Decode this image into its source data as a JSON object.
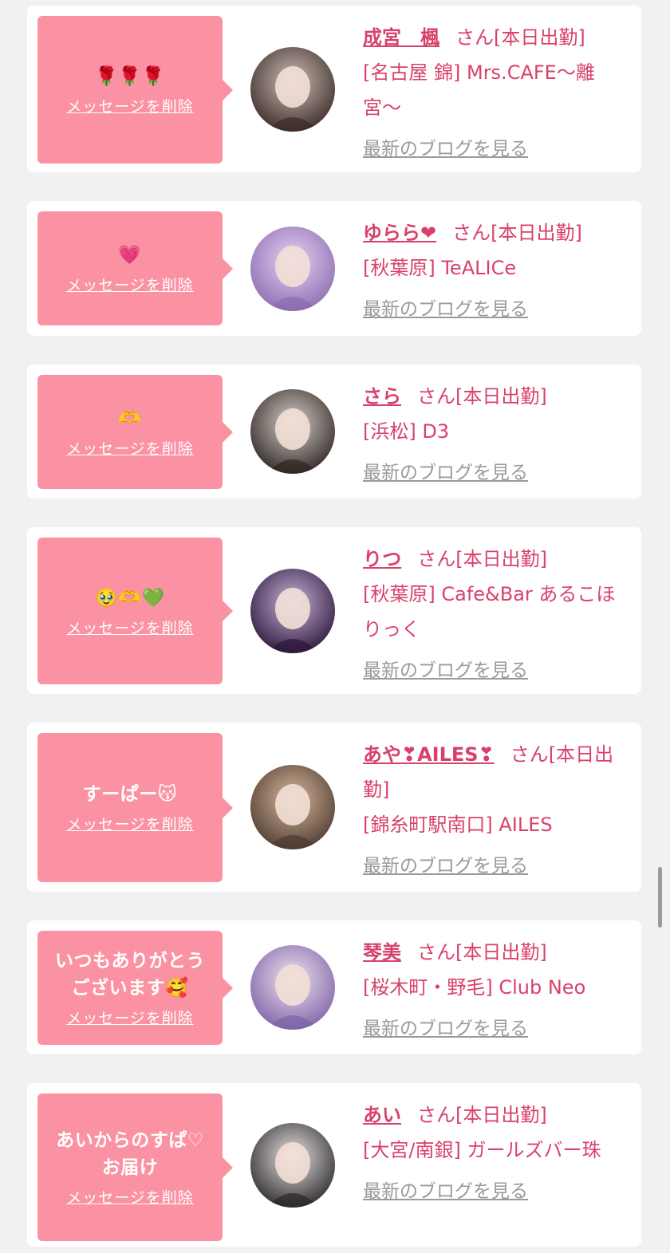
{
  "delete_label": "メッセージを削除",
  "blog_label": "最新のブログを見る",
  "cards": [
    {
      "message": "🌹🌹🌹",
      "name": "成宮　楓",
      "status": "さん[本日出勤]",
      "shop": "[名古屋 錦] Mrs.CAFE〜離宮〜",
      "avatar_colors": [
        "#cbbdb6",
        "#3a2a26"
      ]
    },
    {
      "message": "💗",
      "name": "ゆらら❤",
      "status": "さん[本日出勤]",
      "shop": "[秋葉原] TeALICe",
      "avatar_colors": [
        "#e6d2f2",
        "#8b6bb0"
      ]
    },
    {
      "message": "🫶",
      "name": "さら",
      "status": "さん[本日出勤]",
      "shop": "[浜松] D3",
      "avatar_colors": [
        "#d8cfc9",
        "#2c2522"
      ]
    },
    {
      "message": "🥹🫶💚",
      "name": "りつ",
      "status": "さん[本日出勤]",
      "shop": "[秋葉原] Cafe&Bar あるこほりっく",
      "avatar_colors": [
        "#c7b3d9",
        "#2b1639"
      ]
    },
    {
      "message": "すーぱー😽",
      "name": "あや❣AILES❣",
      "status": "さん[本日出勤]",
      "shop": "[錦糸町駅南口] AILES",
      "avatar_colors": [
        "#d9b79b",
        "#4b3a30"
      ]
    },
    {
      "message": "いつもありがとう\nございます🥰",
      "name": "琴美",
      "status": "さん[本日出勤]",
      "shop": "[桜木町・野毛] Club Neo",
      "avatar_colors": [
        "#efe2ef",
        "#7d62a6"
      ]
    },
    {
      "message": "あいからのすぱ♡\nお届け",
      "name": "あい",
      "status": "さん[本日出勤]",
      "shop": "[大宮/南銀] ガールズバー珠",
      "avatar_colors": [
        "#e8e4e4",
        "#2a2729"
      ]
    }
  ]
}
